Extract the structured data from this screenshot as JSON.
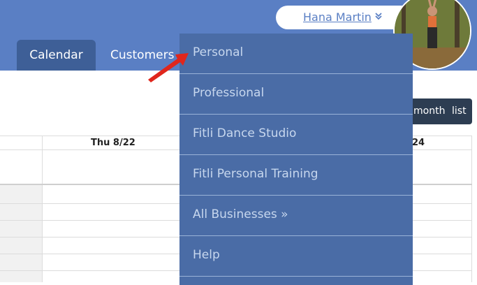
{
  "header": {
    "user_name": "Hana Martin",
    "tabs": [
      {
        "label": "Calendar",
        "active": true
      },
      {
        "label": "Customers",
        "active": false
      }
    ]
  },
  "view_toggle": {
    "month": "month",
    "list": "list"
  },
  "calendar": {
    "day_headers": [
      "Thu 8/22",
      "24"
    ]
  },
  "menu": {
    "items": [
      {
        "label": "Personal"
      },
      {
        "label": "Professional"
      },
      {
        "label": "Fitli Dance Studio"
      },
      {
        "label": "Fitli Personal Training"
      },
      {
        "label": "All Businesses »"
      },
      {
        "label": "Help"
      }
    ]
  },
  "colors": {
    "header_blue": "#5a7fc4",
    "active_tab": "#3e5f97",
    "menu_bg": "#4a6ca6",
    "menu_text": "#c7d7ee",
    "toggle_bg": "#2d3d52",
    "annotation_arrow": "#e0261c"
  },
  "icons": {
    "chevron": "double-chevron-down-icon",
    "annotation": "red-arrow-icon"
  }
}
